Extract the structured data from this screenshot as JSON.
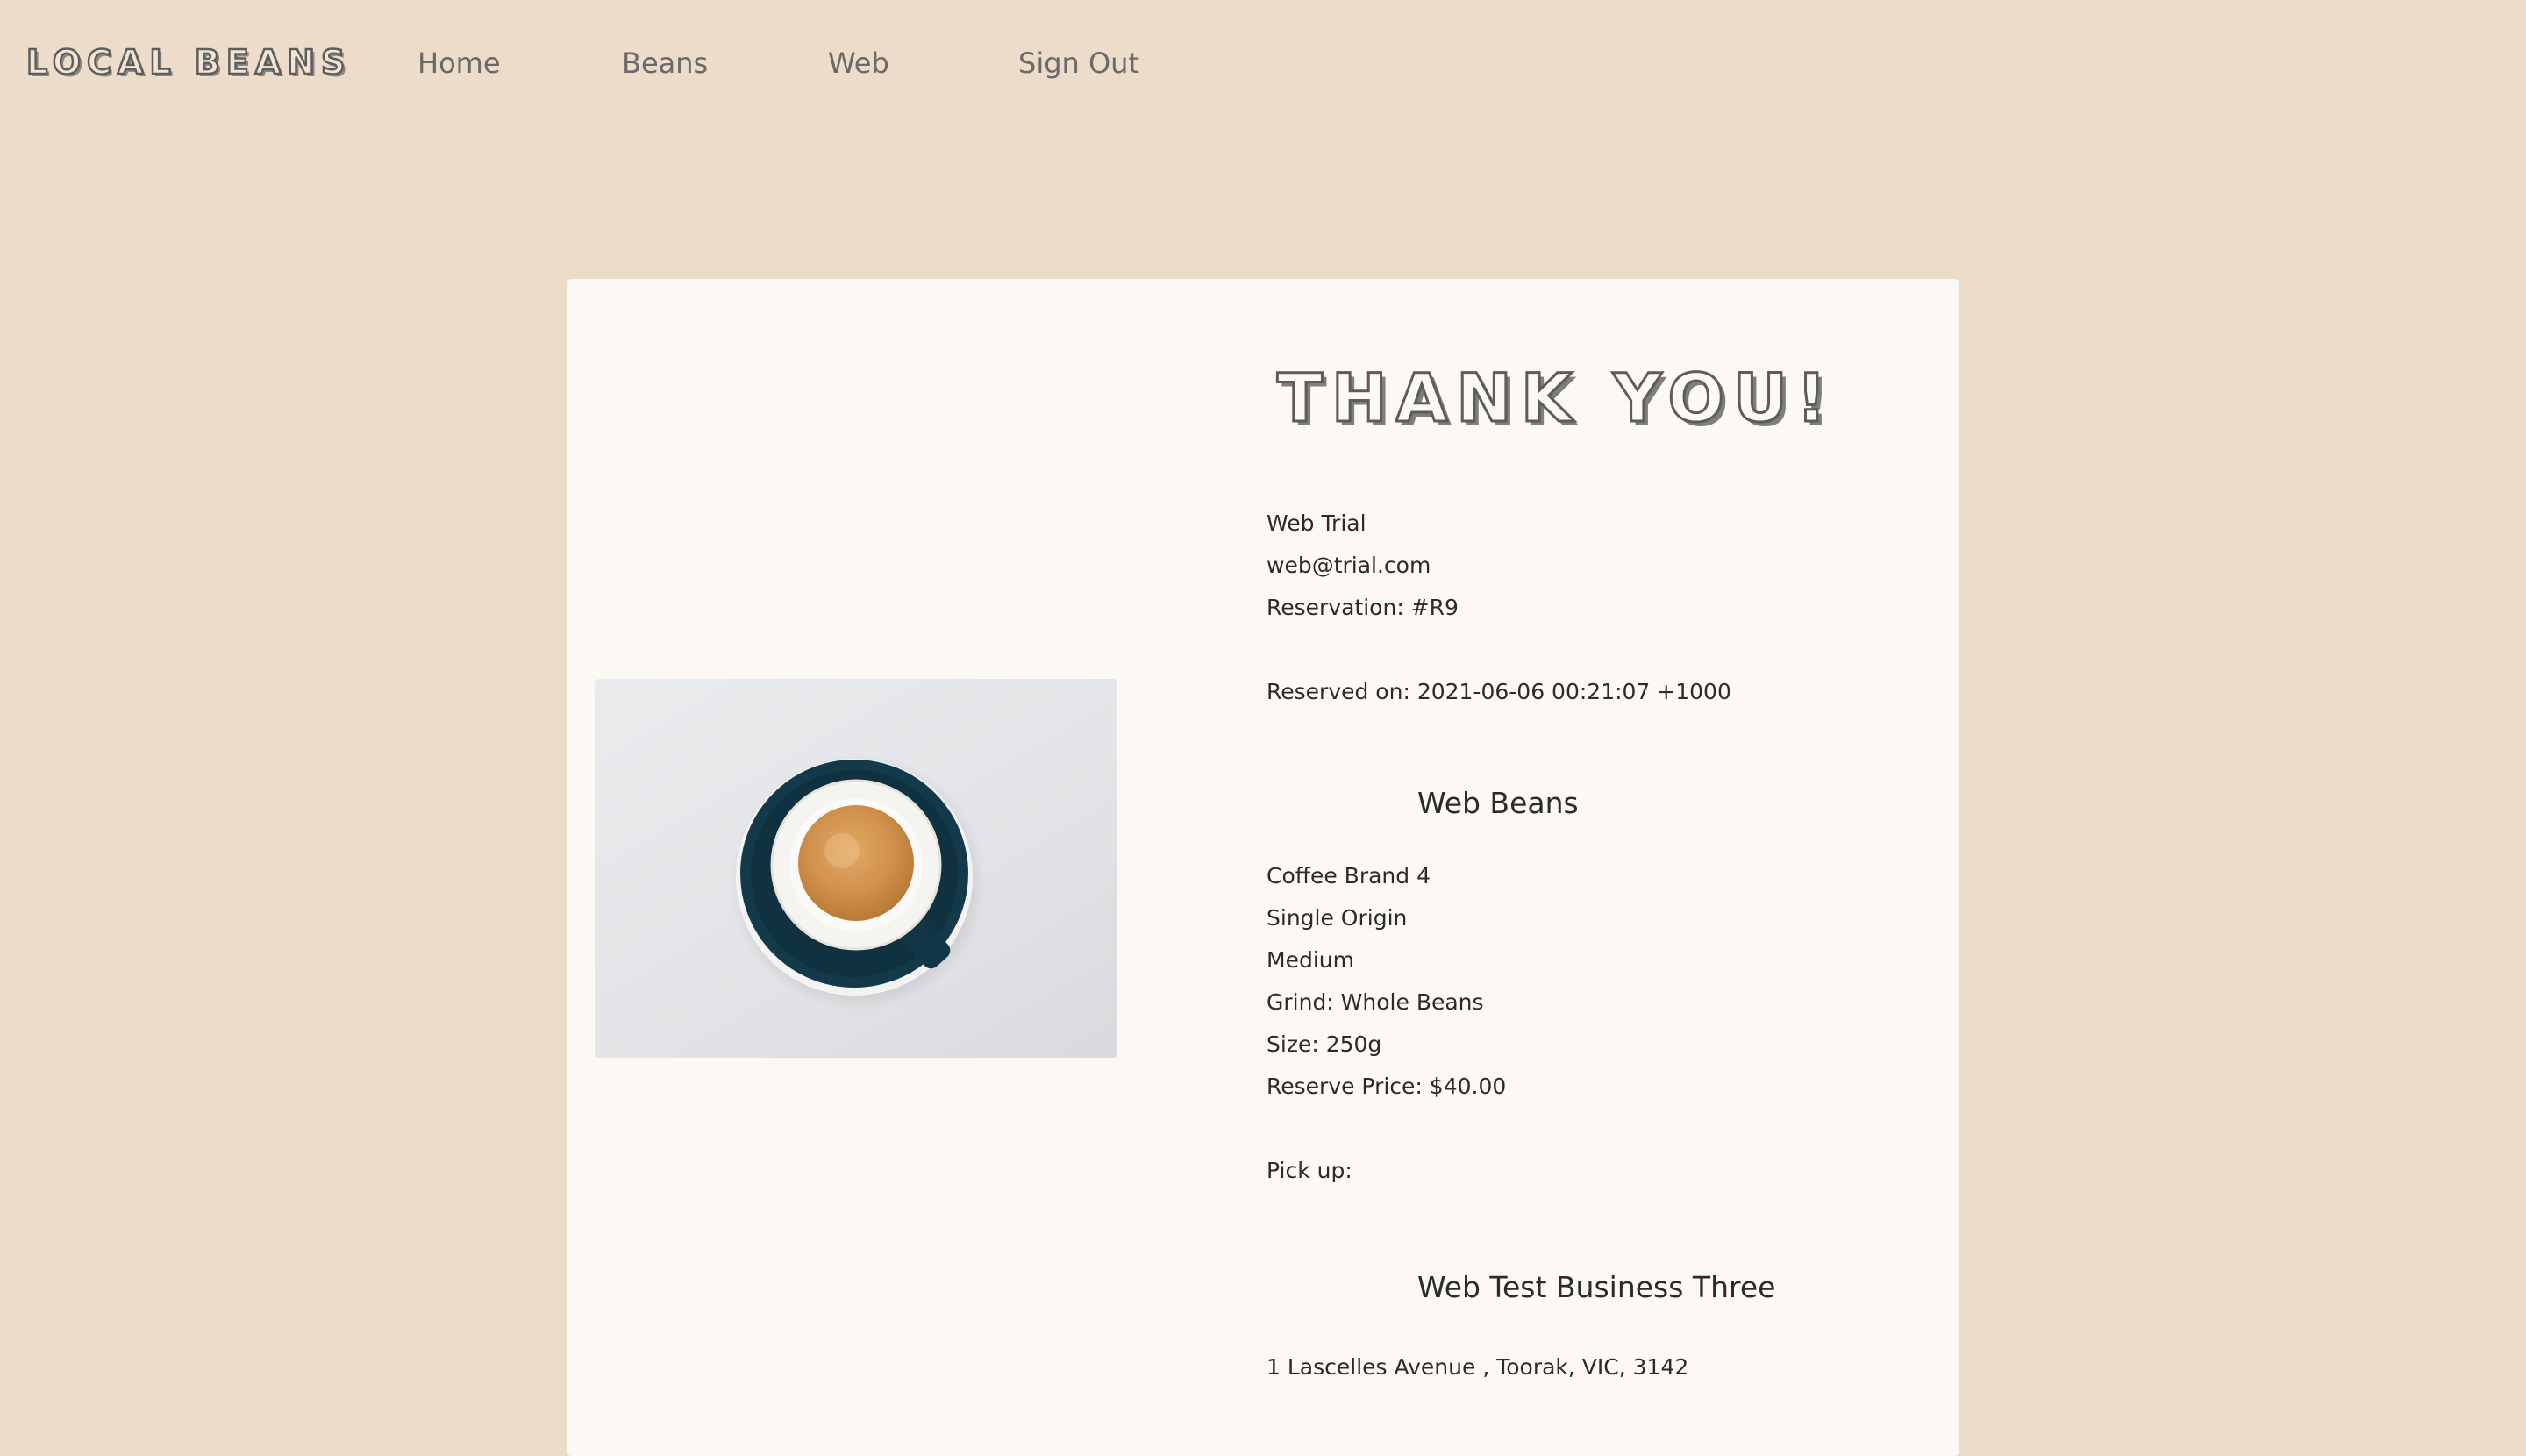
{
  "nav": {
    "brand": "LOCAL BEANS",
    "links": [
      "Home",
      "Beans",
      "Web",
      "Sign Out"
    ]
  },
  "card": {
    "title": "THANK YOU!",
    "image_alt": "espresso cup on saucer",
    "customer": {
      "name": "Web Trial",
      "email": "web@trial.com",
      "reservation": "Reservation: #R9",
      "reserved_on": "Reserved on: 2021-06-06 00:21:07 +1000"
    },
    "product": {
      "heading": "Web Beans",
      "brand": "Coffee Brand 4",
      "origin": "Single Origin",
      "roast": "Medium",
      "grind": "Grind: Whole Beans",
      "size": "Size: 250g",
      "price": "Reserve Price: $40.00"
    },
    "pickup": {
      "label": "Pick up:",
      "business": "Web Test Business Three",
      "address": "1 Lascelles Avenue , Toorak, VIC, 3142"
    }
  },
  "colors": {
    "page_bg": "#eedcca",
    "card_bg": "#fcf9f5",
    "saucer": "#123a4a",
    "crema": "#d2944f"
  }
}
